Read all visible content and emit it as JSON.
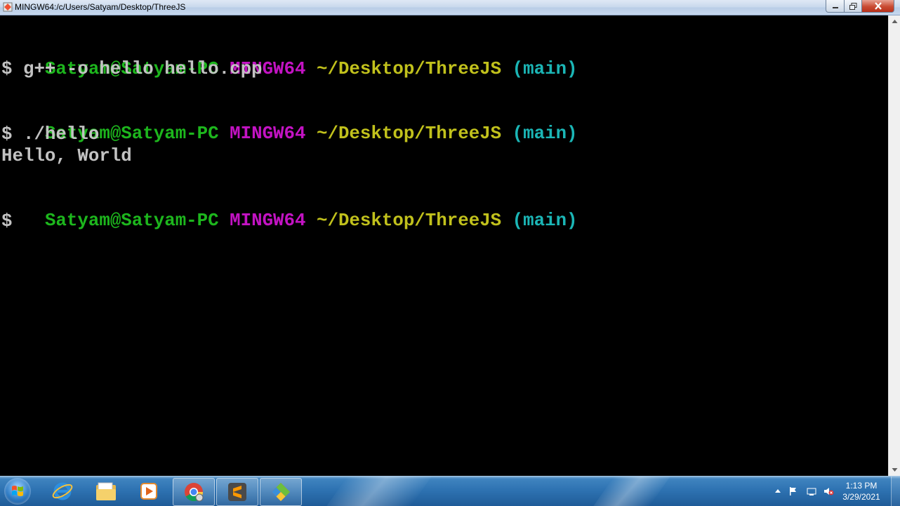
{
  "window": {
    "title": "MINGW64:/c/Users/Satyam/Desktop/ThreeJS"
  },
  "terminal": {
    "colors": {
      "user_host": "#1db61d",
      "system": "#c313c3",
      "path": "#c1c11c",
      "branch": "#1bb6b6",
      "text": "#c2c2c2",
      "background": "#000000"
    },
    "prompt1": {
      "user_host": "Satyam@Satyam-PC",
      "system": "MINGW64",
      "path": "~/Desktop/ThreeJS",
      "branch": "(main)"
    },
    "command1": "$ g++ -o hello hello.cpp",
    "prompt2": {
      "user_host": "Satyam@Satyam-PC",
      "system": "MINGW64",
      "path": "~/Desktop/ThreeJS",
      "branch": "(main)"
    },
    "command2": "$ ./hello",
    "output2": "Hello, World",
    "prompt3": {
      "user_host": "Satyam@Satyam-PC",
      "system": "MINGW64",
      "path": "~/Desktop/ThreeJS",
      "branch": "(main)"
    },
    "command3": "$"
  },
  "taskbar": {
    "apps": [
      {
        "name": "internet-explorer-icon"
      },
      {
        "name": "file-explorer-icon"
      },
      {
        "name": "media-player-icon"
      },
      {
        "name": "chrome-icon"
      },
      {
        "name": "sublime-text-icon"
      },
      {
        "name": "git-bash-icon"
      }
    ],
    "clock": {
      "time": "1:13 PM",
      "date": "3/29/2021"
    }
  }
}
